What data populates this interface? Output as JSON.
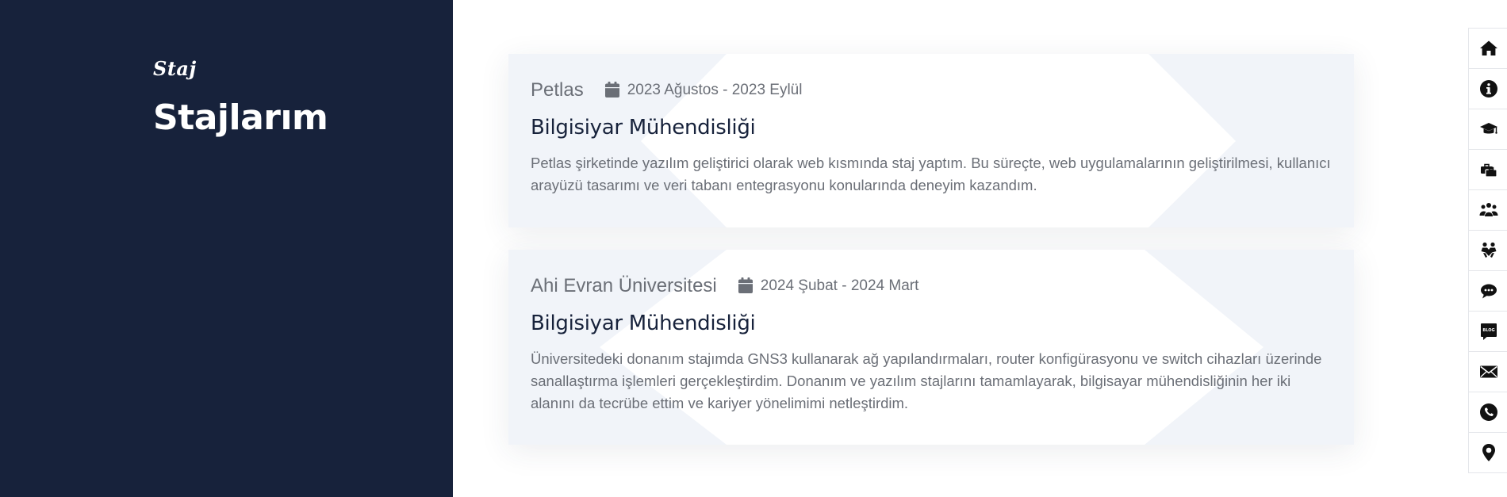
{
  "section": {
    "kicker": "Staj",
    "title": "Stajlarım"
  },
  "internships": [
    {
      "company": "Petlas",
      "date": "2023 Ağustos - 2023 Eylül",
      "role": "Bilgisiyar Mühendisliği",
      "description": "Petlas şirketinde yazılım geliştirici olarak web kısmında staj yaptım. Bu süreçte, web uygulamalarının geliştirilmesi, kullanıcı arayüzü tasarımı ve veri tabanı entegrasyonu konularında deneyim kazandım."
    },
    {
      "company": "Ahi Evran Üniversitesi",
      "date": "2024 Şubat - 2024 Mart",
      "role": "Bilgisiyar Mühendisliği",
      "description": "Üniversitedeki donanım stajımda GNS3 kullanarak ağ yapılandırmaları, router konfigürasyonu ve switch cihazları üzerinde sanallaştırma işlemleri gerçekleştirdim. Donanım ve yazılım stajlarını tamamlayarak, bilgisayar mühendisliğinin her iki alanını da tecrübe ettim ve kariyer yönelimimi netleştirdim."
    }
  ],
  "nav_icons": [
    "home-icon",
    "info-icon",
    "graduation-cap-icon",
    "briefcase-icon",
    "users-icon",
    "handshake-icon",
    "chat-bubbles-icon",
    "blog-icon",
    "envelope-icon",
    "phone-icon",
    "location-pin-icon"
  ],
  "nav_icon_badge": "BLOG",
  "colors": {
    "panel_dark": "#17223b",
    "card_bg": "#f1f4f9",
    "text_muted": "#6b6f77",
    "heading_dark": "#17223b"
  }
}
